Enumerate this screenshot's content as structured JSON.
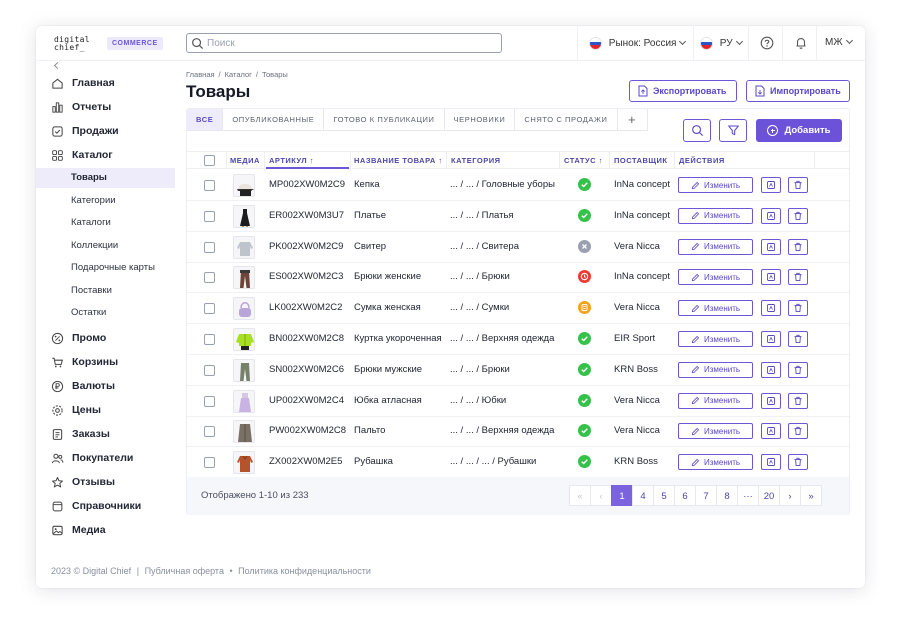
{
  "brand": {
    "logo_line1": "digital",
    "logo_line2": "chief_",
    "badge": "COMMERCE"
  },
  "search": {
    "placeholder": "Поиск"
  },
  "topbar": {
    "market": "Рынок: Россия",
    "language": "РУ",
    "user": "МЖ"
  },
  "sidebar": {
    "items": [
      {
        "label": "Главная",
        "icon": "home-icon"
      },
      {
        "label": "Отчеты",
        "icon": "reports-icon"
      },
      {
        "label": "Продажи",
        "icon": "sales-icon"
      },
      {
        "label": "Каталог",
        "icon": "catalog-icon"
      },
      {
        "label": "Промо",
        "icon": "promo-icon"
      },
      {
        "label": "Корзины",
        "icon": "cart-icon"
      },
      {
        "label": "Валюты",
        "icon": "currency-icon"
      },
      {
        "label": "Цены",
        "icon": "prices-icon"
      },
      {
        "label": "Заказы",
        "icon": "orders-icon"
      },
      {
        "label": "Покупатели",
        "icon": "customers-icon"
      },
      {
        "label": "Отзывы",
        "icon": "star-icon"
      },
      {
        "label": "Справочники",
        "icon": "dictionary-icon"
      },
      {
        "label": "Медиа",
        "icon": "media-icon"
      }
    ],
    "catalog_sub": [
      "Товары",
      "Категории",
      "Каталоги",
      "Коллекции",
      "Подарочные карты",
      "Поставки",
      "Остатки"
    ]
  },
  "breadcrumb": [
    "Главная",
    "Каталог",
    "Товары"
  ],
  "page": {
    "title": "Товары",
    "export_label": "Экспортировать",
    "import_label": "Импортировать",
    "add_label": "Добавить"
  },
  "tabs": [
    "ВСЕ",
    "ОПУБЛИКОВАННЫЕ",
    "ГОТОВО К ПУБЛИКАЦИИ",
    "ЧЕРНОВИКИ",
    "СНЯТО С ПРОДАЖИ"
  ],
  "table": {
    "columns": {
      "media": "МЕДИА",
      "sku": "АРТИКУЛ ↑",
      "name": "НАЗВАНИЕ ТОВАРА ↑",
      "category": "КАТЕГОРИЯ",
      "status": "СТАТУС ↑",
      "supplier": "ПОСТАВЩИК",
      "actions": "ДЕЙСТВИЯ"
    },
    "edit_label": "Изменить",
    "rows": [
      {
        "sku": "MP002XW0M2C9",
        "name": "Кепка",
        "category": "... / ... / Головные уборы",
        "status": "published",
        "supplier": "InNa concept",
        "image": "cap"
      },
      {
        "sku": "ER002XW0M3U7",
        "name": "Платье",
        "category": "... / ... / Платья",
        "status": "published",
        "supplier": "InNa concept",
        "image": "dress"
      },
      {
        "sku": "PK002XW0M2C9",
        "name": "Свитер",
        "category": "... / ... / Свитера",
        "status": "draft",
        "supplier": "Vera Nicca",
        "image": "sweater"
      },
      {
        "sku": "ES002XW0M2C3",
        "name": "Брюки женские",
        "category": "... / ... / Брюки",
        "status": "withdrawn",
        "supplier": "InNa concept",
        "image": "trousers"
      },
      {
        "sku": "LK002XW0M2C2",
        "name": "Сумка женская",
        "category": "... / ... / Сумки",
        "status": "ready",
        "supplier": "Vera Nicca",
        "image": "bag"
      },
      {
        "sku": "BN002XW0M2C8",
        "name": "Куртка укороченная",
        "category": "... / ... / Верхняя одежда",
        "status": "published",
        "supplier": "EIR Sport",
        "image": "jacket"
      },
      {
        "sku": "SN002XW0M2C6",
        "name": "Брюки мужские",
        "category": "... / ... / Брюки",
        "status": "published",
        "supplier": "KRN Boss",
        "image": "pants"
      },
      {
        "sku": "UP002XW0M2C4",
        "name": "Юбка атласная",
        "category": "... / ... / Юбки",
        "status": "published",
        "supplier": "Vera Nicca",
        "image": "skirt"
      },
      {
        "sku": "PW002XW0M2C8",
        "name": "Пальто",
        "category": "... / ... / Верхняя одежда",
        "status": "published",
        "supplier": "Vera Nicca",
        "image": "coat"
      },
      {
        "sku": "ZX002XW0M2E5",
        "name": "Рубашка",
        "category": "... / ... / ... / Рубашки",
        "status": "published",
        "supplier": "KRN Boss",
        "image": "shirt"
      }
    ]
  },
  "status_colors": {
    "published": "#34c24a",
    "draft": "#9aa0b0",
    "withdrawn": "#f03a2e",
    "ready": "#f6a11a"
  },
  "pagination": {
    "summary": "Отображено 1-10 из 233",
    "pages": [
      "1",
      "4",
      "5",
      "6",
      "7",
      "8",
      "···",
      "20"
    ],
    "current": "1"
  },
  "footer": {
    "copyright": "2023 © Digital Chief",
    "sep1": "|",
    "offer": "Публичная оферта",
    "sep2": "•",
    "privacy": "Политика конфиденциальности"
  }
}
